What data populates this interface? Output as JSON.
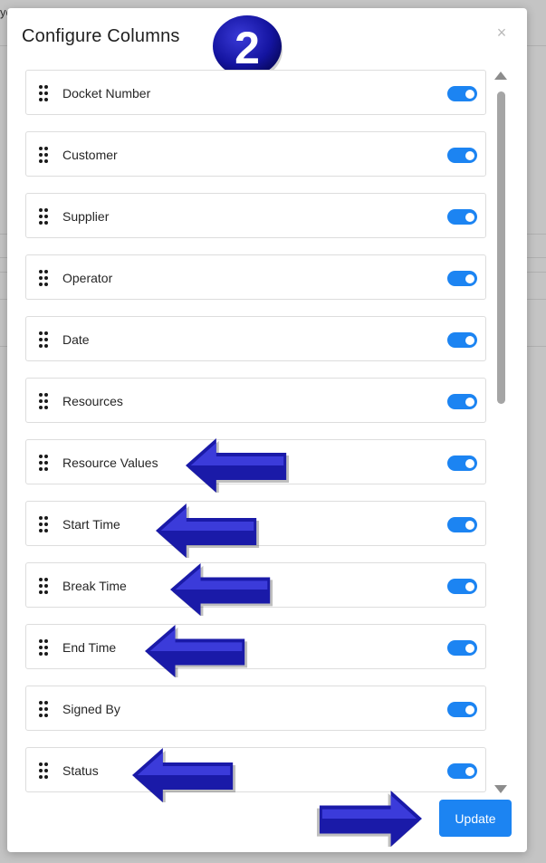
{
  "background": {
    "partial_text": "yo"
  },
  "modal": {
    "title": "Configure Columns",
    "step_badge": "2",
    "close_glyph": "×",
    "update_label": "Update",
    "accent_color": "#1c84f2",
    "columns": [
      {
        "label": "Docket Number",
        "enabled": true
      },
      {
        "label": "Customer",
        "enabled": true
      },
      {
        "label": "Supplier",
        "enabled": true
      },
      {
        "label": "Operator",
        "enabled": true
      },
      {
        "label": "Date",
        "enabled": true
      },
      {
        "label": "Resources",
        "enabled": true
      },
      {
        "label": "Resource Values",
        "enabled": true
      },
      {
        "label": "Start Time",
        "enabled": true
      },
      {
        "label": "Break Time",
        "enabled": true
      },
      {
        "label": "End Time",
        "enabled": true
      },
      {
        "label": "Signed By",
        "enabled": true
      },
      {
        "label": "Status",
        "enabled": true
      }
    ]
  },
  "annotations": {
    "arrow_color": "#1a1aa8",
    "highlighted_columns": [
      "Resource Values",
      "Start Time",
      "Break Time",
      "End Time",
      "Status"
    ],
    "points_to": "update-button"
  }
}
